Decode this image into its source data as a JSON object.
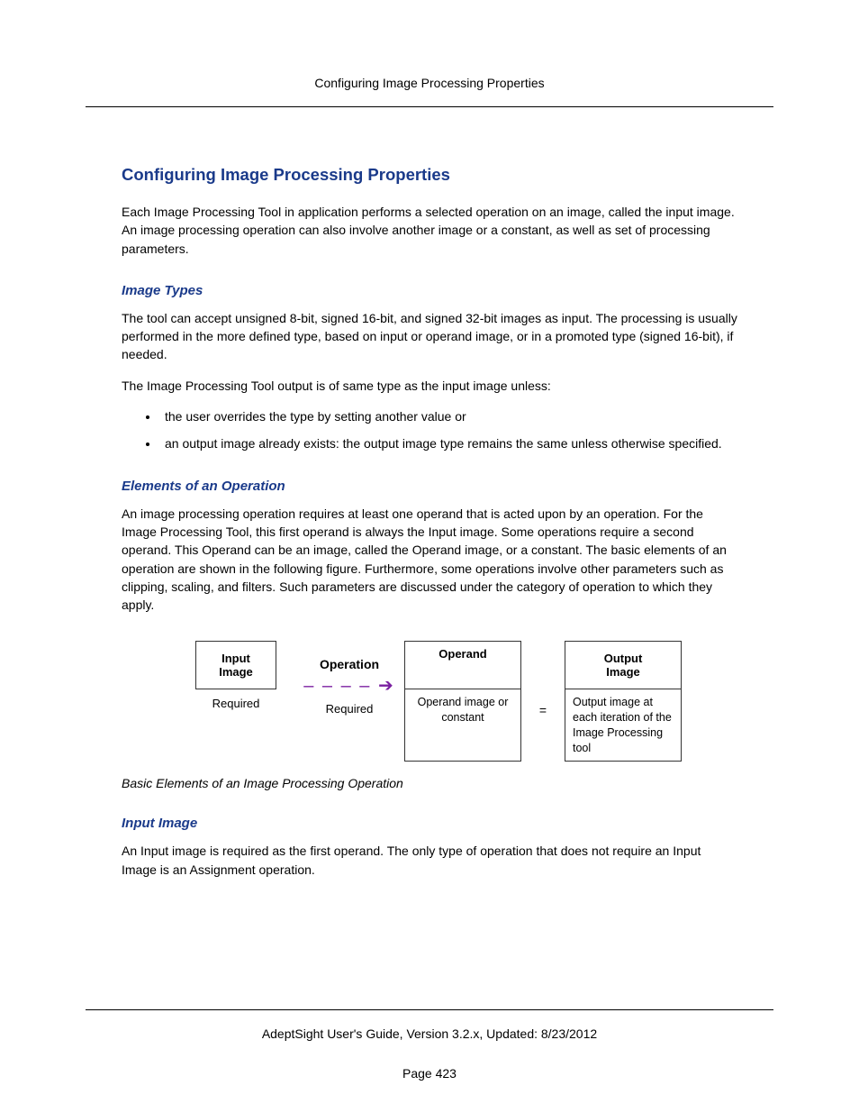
{
  "header": {
    "running_title": "Configuring Image Processing Properties"
  },
  "section": {
    "title": "Configuring Image Processing Properties",
    "intro": "Each Image Processing Tool in application performs a selected operation on an image, called the input image. An image processing operation can also involve another image or a constant, as well as set of processing parameters."
  },
  "image_types": {
    "heading": "Image Types",
    "p1": "The tool can accept unsigned 8-bit, signed 16-bit, and signed 32-bit images as input. The processing is usually performed in the more defined type, based on input or operand image, or in a promoted type (signed 16-bit), if needed.",
    "p2": "The Image Processing Tool output is of same type as the input image unless:",
    "bullets": [
      "the user overrides the type by setting another value or",
      "an output image already exists: the output image type remains the same unless otherwise specified."
    ]
  },
  "elements": {
    "heading": "Elements of an Operation",
    "p1": "An image processing operation requires at least one operand that is acted upon by an operation. For the Image Processing Tool, this first operand is always the Input image. Some operations require a second operand. This Operand can be an image, called the Operand image, or a constant. The basic elements of an operation are shown in the following figure. Furthermore, some operations involve other parameters such as clipping, scaling, and filters. Such parameters are discussed under the category of operation to which they apply."
  },
  "diagram": {
    "input_box": "Input\nImage",
    "input_sub": "Required",
    "operation_label": "Operation",
    "operation_sub": "Required",
    "operand_box": "Operand",
    "operand_sub": "Operand image or constant",
    "equals": "=",
    "output_box": "Output\nImage",
    "output_sub": "Output image at each iteration of the Image Processing tool",
    "caption": "Basic Elements of an Image Processing Operation"
  },
  "input_image": {
    "heading": "Input Image",
    "p1": "An Input image is required as the first operand. The only type of operation that does not require an Input Image is an Assignment operation."
  },
  "footer": {
    "line": "AdeptSight User's Guide,  Version 3.2.x, Updated: 8/23/2012",
    "page": "Page 423"
  }
}
